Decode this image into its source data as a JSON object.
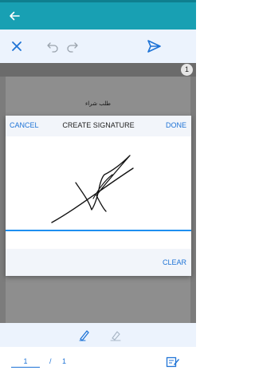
{
  "colors": {
    "appbar": "#18a0b3",
    "accent": "#1e73d6",
    "toolbar_bg": "#ecf3fd",
    "doc_bg": "#7c7c7c",
    "signature_line": "#1e8ff0"
  },
  "app_bar": {
    "back_icon": "arrow-left-icon"
  },
  "toolbar": {
    "close_icon": "close-icon",
    "undo_icon": "undo-icon",
    "redo_icon": "redo-icon",
    "send_icon": "send-icon"
  },
  "document": {
    "page_badge": "1",
    "title": "طلب شراء"
  },
  "dialog": {
    "cancel_label": "CANCEL",
    "title": "CREATE SIGNATURE",
    "done_label": "DONE",
    "clear_label": "CLEAR"
  },
  "tools": {
    "pen_icon": "pen-icon",
    "highlighter_icon": "highlighter-icon"
  },
  "pager": {
    "current_page": "1",
    "separator": "/",
    "total_pages": "1",
    "edit_icon": "edit-note-icon"
  }
}
